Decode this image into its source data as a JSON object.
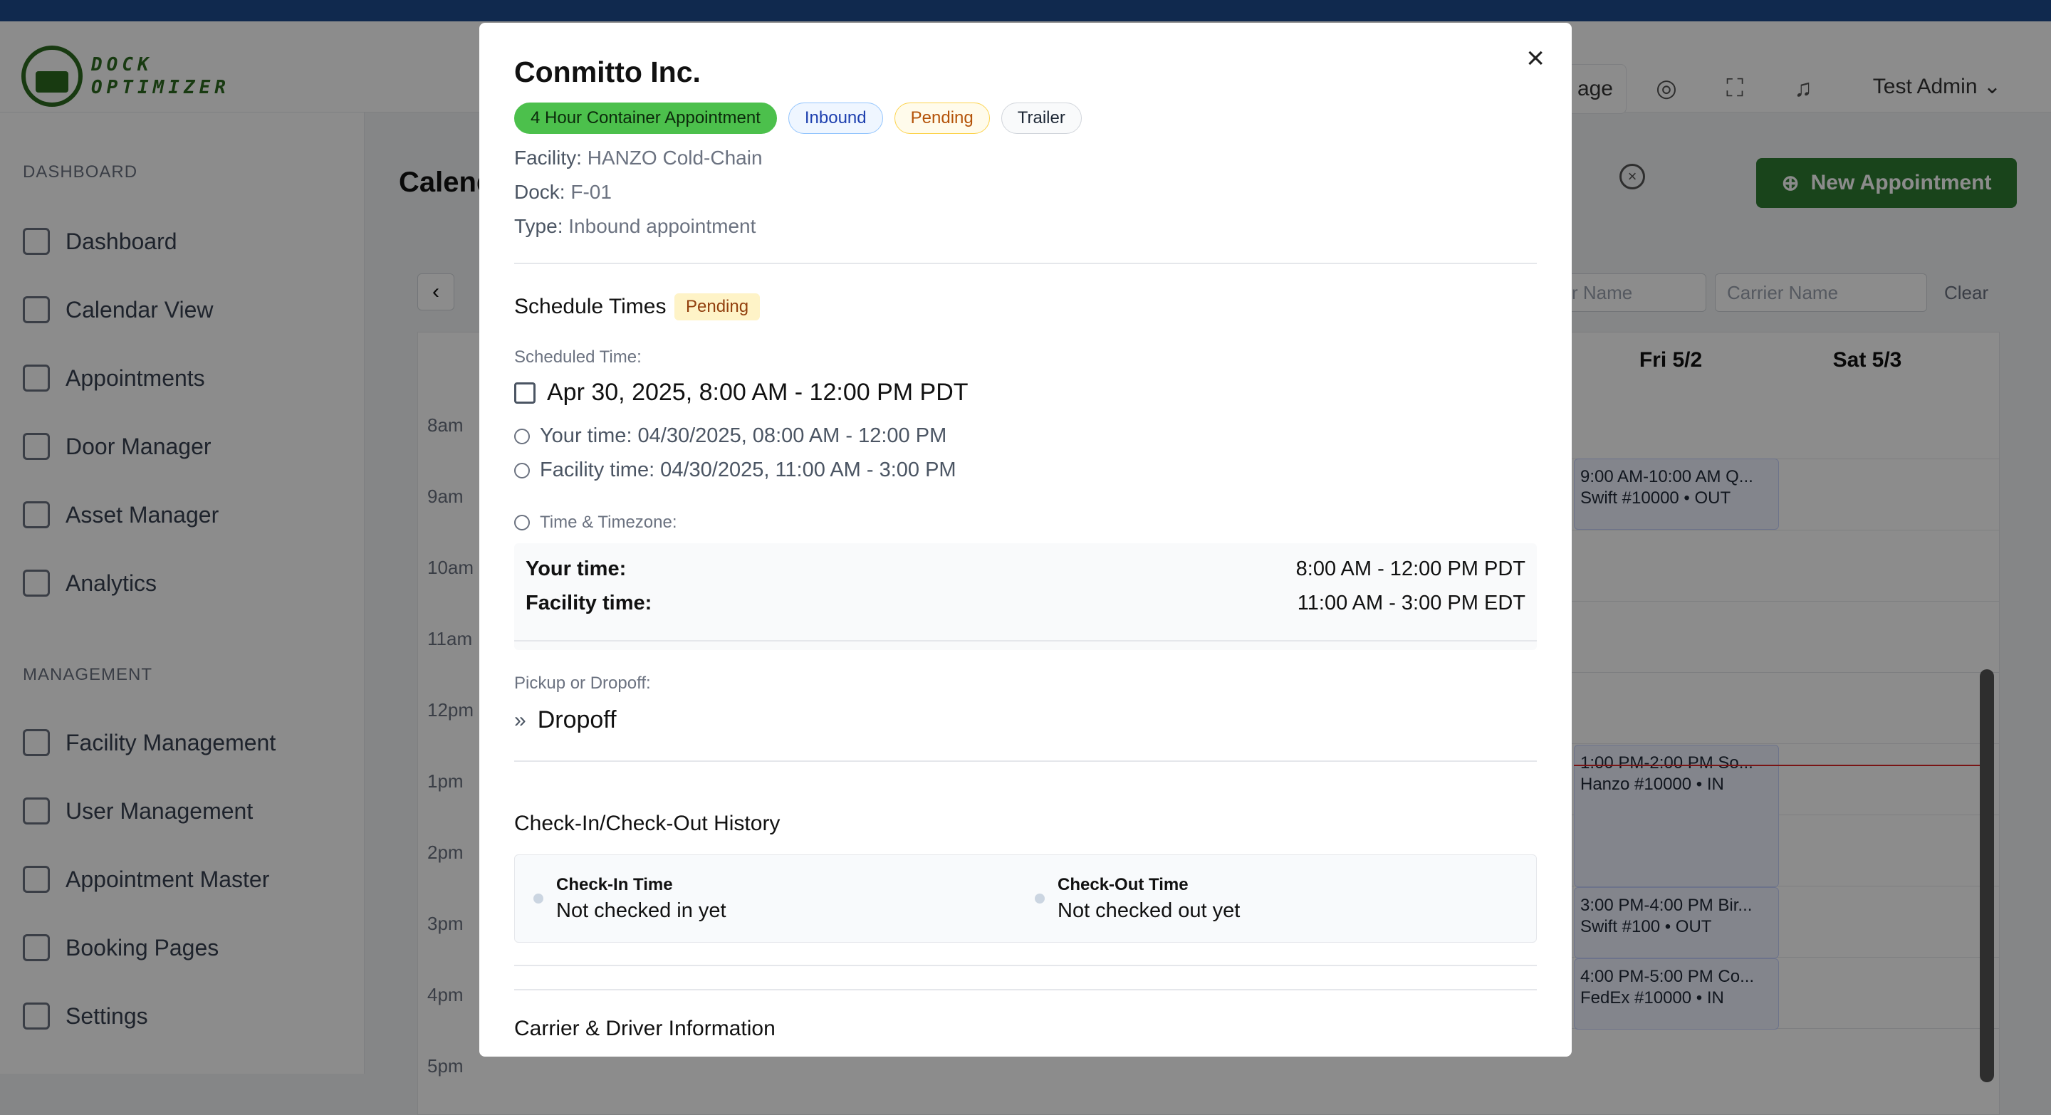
{
  "app": {
    "logo_text_1": "DOCK",
    "logo_text_2": "OPTIMIZER",
    "header_btn_label": "age",
    "user_name": "Test Admin"
  },
  "sidebar": {
    "section_dashboard": "DASHBOARD",
    "section_management": "MANAGEMENT",
    "items": [
      {
        "label": "Dashboard"
      },
      {
        "label": "Calendar View"
      },
      {
        "label": "Appointments"
      },
      {
        "label": "Door Manager"
      },
      {
        "label": "Asset Manager"
      },
      {
        "label": "Analytics"
      },
      {
        "label": "Facility Management"
      },
      {
        "label": "User Management"
      },
      {
        "label": "Appointment Master"
      },
      {
        "label": "Booking Pages"
      },
      {
        "label": "Settings"
      }
    ]
  },
  "main": {
    "title": "Calend",
    "new_appointment": "New Appointment",
    "filter_1": "r Name",
    "filter_2": "Carrier Name",
    "clear": "Clear",
    "days": [
      "Fri 5/2",
      "Sat 5/3"
    ],
    "hours": [
      "8am",
      "9am",
      "10am",
      "11am",
      "12pm",
      "1pm",
      "2pm",
      "3pm",
      "4pm",
      "5pm"
    ],
    "events": [
      {
        "line1": "9:00 AM-10:00 AM Q...",
        "line2": "Swift #10000 • OUT"
      },
      {
        "line1": "1:00 PM-2:00 PM So...",
        "line2": "Hanzo #10000 • IN"
      },
      {
        "line1": "3:00 PM-4:00 PM Bir...",
        "line2": "Swift #100 • OUT"
      },
      {
        "line1": "4:00 PM-5:00 PM Co...",
        "line2": "FedEx #10000 • IN"
      }
    ]
  },
  "modal": {
    "title": "Conmitto Inc.",
    "badges": [
      "4 Hour Container Appointment",
      "Inbound",
      "Pending",
      "Trailer"
    ],
    "facility_label": "Facility:",
    "facility_value": "HANZO Cold-Chain",
    "dock_label": "Dock:",
    "dock_value": "F-01",
    "type_label": "Type:",
    "type_value": "Inbound appointment",
    "schedule_title": "Schedule Times",
    "schedule_status": "Pending",
    "scheduled_label": "Scheduled Time:",
    "scheduled_value": "Apr 30, 2025, 8:00 AM - 12:00 PM PDT",
    "your_time_line": "Your time: 04/30/2025, 08:00 AM - 12:00 PM",
    "facility_time_line": "Facility time: 04/30/2025, 11:00 AM - 3:00 PM",
    "tz_label": "Time & Timezone:",
    "tz_your_key": "Your time:",
    "tz_your_val": "8:00 AM - 12:00 PM PDT",
    "tz_fac_key": "Facility time:",
    "tz_fac_val": "11:00 AM - 3:00 PM EDT",
    "pickup_label": "Pickup or Dropoff:",
    "pickup_value": "Dropoff",
    "history_title": "Check-In/Check-Out History",
    "checkin_key": "Check-In Time",
    "checkin_val": "Not checked in yet",
    "checkout_key": "Check-Out Time",
    "checkout_val": "Not checked out yet",
    "carrier_title": "Carrier & Driver Information"
  },
  "colors": {
    "brand": "#2d6a1f",
    "topbar": "#1e4b8f",
    "badge_green": "#4cc04c"
  }
}
